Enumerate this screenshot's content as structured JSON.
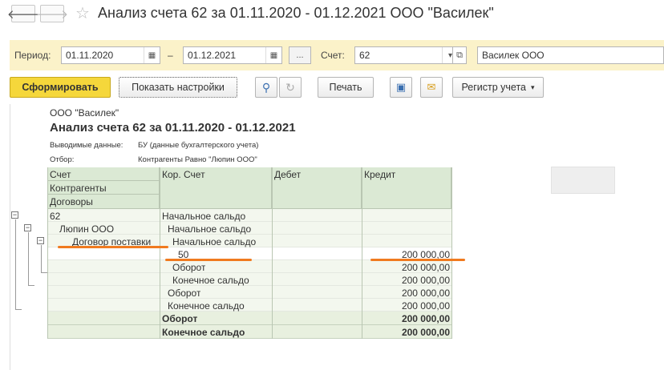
{
  "window": {
    "title": "Анализ счета 62 за 01.11.2020 - 01.12.2021 ООО \"Василек\"",
    "back_glyph": "🡐",
    "forward_glyph": "🡒",
    "favorite_glyph": "☆"
  },
  "params": {
    "period_label": "Период:",
    "date_from": "01.11.2020",
    "dash": "–",
    "date_to": "01.12.2021",
    "more_label": "...",
    "account_label": "Счет:",
    "account_value": "62",
    "org_value": "Василек ООО"
  },
  "toolbar": {
    "generate_label": "Сформировать",
    "settings_label": "Показать настройки",
    "print_label": "Печать",
    "register_label": "Регистр учета"
  },
  "report": {
    "org": "ООО \"Василек\"",
    "title": "Анализ счета 62 за 01.11.2020 - 01.12.2021",
    "output_label": "Выводимые данные:",
    "output_value": "БУ (данные бухгалтерского учета)",
    "filter_label": "Отбор:",
    "filter_value": "Контрагенты Равно \"Люпин ООО\"",
    "headers": {
      "account": "Счет",
      "contractors": "Контрагенты",
      "contracts": "Договоры",
      "corr_account": "Кор. Счет",
      "debit": "Дебет",
      "credit": "Кредит"
    },
    "rows": [
      {
        "c1": "62",
        "c2": "Начальное сальдо",
        "credit": ""
      },
      {
        "c1": "Люпин ООО",
        "c2": "Начальное сальдо",
        "credit": ""
      },
      {
        "c1": "Договор поставки",
        "c2": "Начальное сальдо",
        "credit": ""
      },
      {
        "c1": "",
        "c2": "50",
        "credit": "200 000,00"
      },
      {
        "c1": "",
        "c2": "Оборот",
        "credit": "200 000,00"
      },
      {
        "c1": "",
        "c2": "Конечное сальдо",
        "credit": "200 000,00"
      },
      {
        "c1": "",
        "c2": "Оборот",
        "credit": "200 000,00"
      },
      {
        "c1": "",
        "c2": "Конечное сальдо",
        "credit": "200 000,00"
      }
    ],
    "totals": [
      {
        "label": "Оборот",
        "credit": "200 000,00"
      },
      {
        "label": "Конечное сальдо",
        "credit": "200 000,00"
      }
    ]
  },
  "colors": {
    "accent_button": "#f5d73b",
    "params_bg": "#fbf2c9",
    "header_bg": "#dbe9d4",
    "annotation": "#f07a1f"
  },
  "icons": [
    "back-arrow-icon",
    "forward-arrow-icon",
    "star-icon",
    "calendar-icon",
    "dropdown-icon",
    "open-icon",
    "search-icon",
    "refresh-icon",
    "save-icon",
    "mail-icon",
    "chevron-down-icon"
  ]
}
